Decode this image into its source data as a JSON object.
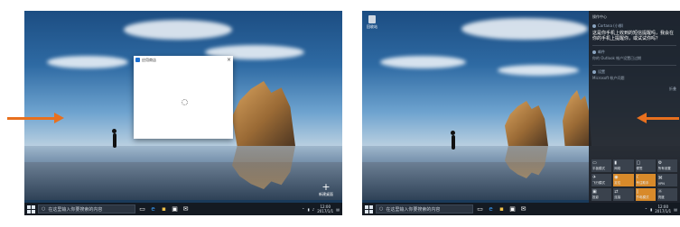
{
  "left": {
    "search_placeholder": "在这里输入你要搜索的内容",
    "dialog": {
      "title": "应用商店"
    },
    "new_desktop": {
      "label": "新建桌面"
    },
    "clock": {
      "time": "12:00",
      "date": "2017/1/1"
    }
  },
  "right": {
    "desktop_icon_label": "回收站",
    "search_placeholder": "在这里输入你要搜索的内容",
    "clock": {
      "time": "12:00",
      "date": "2017/1/1"
    },
    "action_center": {
      "header": "操作中心",
      "cortana_group": "Cortana (小娜)",
      "cortana_msg": "这是你手机上收到的短信提醒吗，我会在你的手机上提醒你，或试试你吗？",
      "mail_group": "邮件",
      "mail_msg": "你的 Outlook 帐户设置已过期",
      "settings_group": "设置",
      "settings_msg": "Microsoft 帐户问题",
      "collapse": "折叠",
      "tiles": [
        {
          "label": "平板模式",
          "icon": "tablet-icon",
          "on": false
        },
        {
          "label": "网络",
          "icon": "network-icon",
          "on": false
        },
        {
          "label": "便签",
          "icon": "note-icon",
          "on": false
        },
        {
          "label": "所有设置",
          "icon": "settings-icon",
          "on": false
        },
        {
          "label": "飞行模式",
          "icon": "airplane-icon",
          "on": false
        },
        {
          "label": "定位",
          "icon": "location-icon",
          "on": true
        },
        {
          "label": "专注助手",
          "icon": "moon-icon",
          "on": true
        },
        {
          "label": "VPN",
          "icon": "vpn-icon",
          "on": false
        },
        {
          "label": "投影",
          "icon": "project-icon",
          "on": false
        },
        {
          "label": "连接",
          "icon": "connect-icon",
          "on": false
        },
        {
          "label": "节电模式",
          "icon": "battery-icon",
          "on": true
        },
        {
          "label": "亮度",
          "icon": "brightness-icon",
          "on": false
        }
      ]
    }
  },
  "colors": {
    "arrow": "#e8701e",
    "accent_tile": "#d88a2a"
  }
}
